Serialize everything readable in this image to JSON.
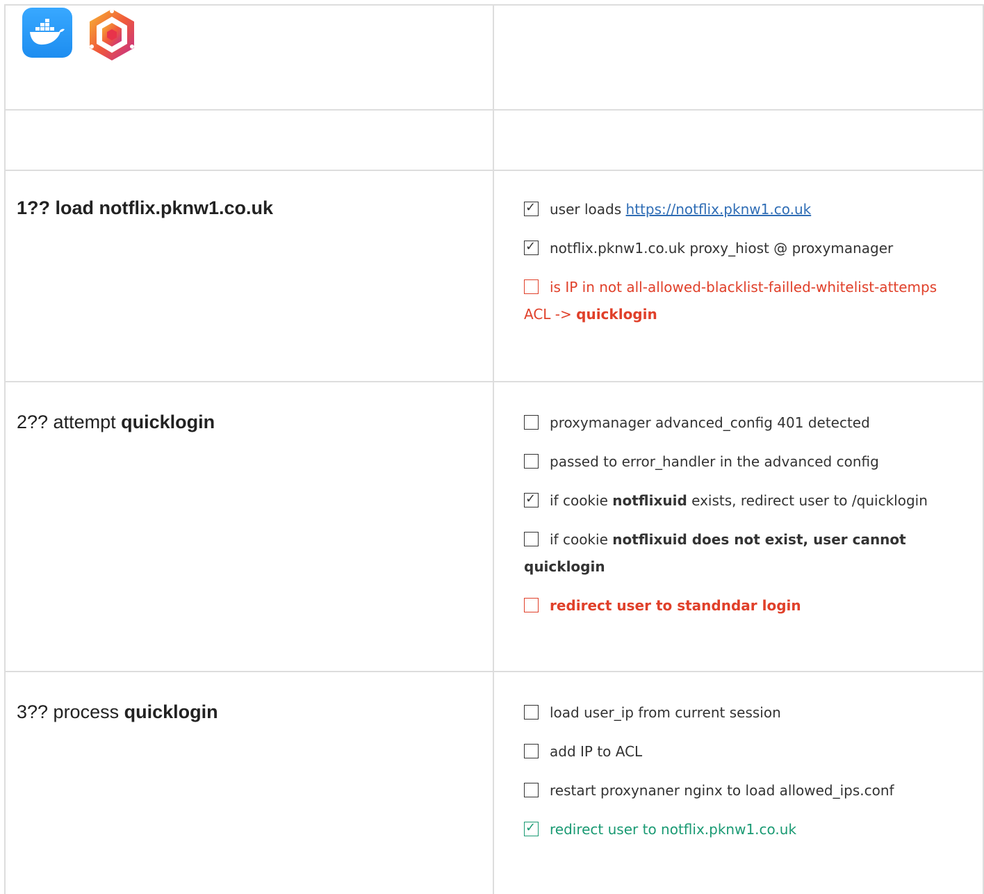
{
  "logos": {
    "docker_icon": "docker-whale-icon",
    "proxy_icon": "hexagon-logo-icon"
  },
  "steps": [
    {
      "title_prefix": "1?? load notflix.pknw1.co.uk",
      "items": [
        {
          "checked": true,
          "text_a": "user loads ",
          "link": "https://notflix.pknw1.co.uk"
        },
        {
          "checked": true,
          "text_a": "notflix.pknw1.co.uk proxy_hiost @ proxymanager"
        },
        {
          "checked": false,
          "color": "red",
          "text_a": "is IP in not all-allowed-blacklist-failled-whitelist-attemps ACL -> ",
          "bold": "quicklogin"
        }
      ]
    },
    {
      "title_prefix": "2?? attempt ",
      "title_bold": "quicklogin",
      "items": [
        {
          "checked": false,
          "text_a": "proxymanager advanced_config 401 detected"
        },
        {
          "checked": false,
          "text_a": "passed to error_handler in the advanced config"
        },
        {
          "checked": true,
          "text_a": "if cookie ",
          "bold": "notflixuid",
          "text_b": " exists, redirect user to /quicklogin"
        },
        {
          "checked": false,
          "text_a": "if cookie ",
          "bold": "notflixuid does not exist, user cannot quicklogin"
        },
        {
          "checked": false,
          "color": "red",
          "bold": "redirect user to standndar login"
        }
      ]
    },
    {
      "title_prefix": "3?? process ",
      "title_bold": "quicklogin",
      "items": [
        {
          "checked": false,
          "text_a": "load user_ip from current session"
        },
        {
          "checked": false,
          "text_a": "add IP to ACL"
        },
        {
          "checked": false,
          "text_a": "restart proxynaner nginx to load allowed_ips.conf"
        },
        {
          "checked": true,
          "color": "green",
          "text_a": "redirect user to notflix.pknw1.co.uk"
        }
      ]
    }
  ],
  "colors": {
    "red": "#e0402a",
    "green": "#1a9a73",
    "link": "#2f6db5",
    "border": "#dddddd"
  }
}
